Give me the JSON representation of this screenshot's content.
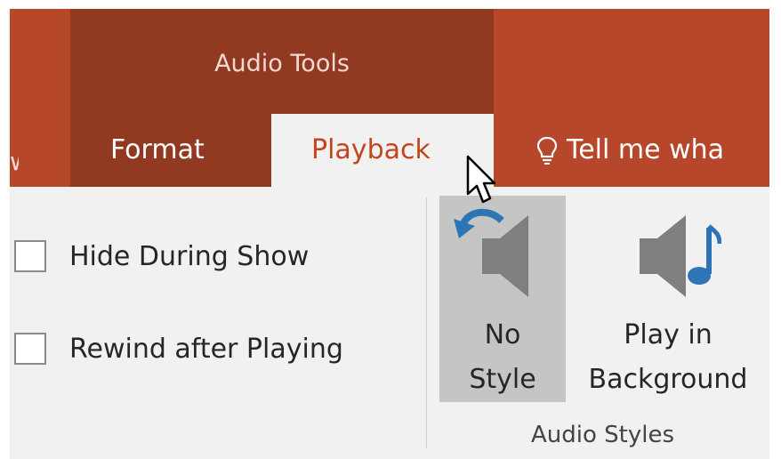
{
  "contextual_group": {
    "title": "Audio Tools"
  },
  "tabs": {
    "partial_left": "w",
    "format": "Format",
    "playback": "Playback",
    "tell_me": "Tell me wha"
  },
  "options": {
    "hide_during_show": "Hide During Show",
    "rewind_after_playing": "Rewind after Playing"
  },
  "audio_styles": {
    "no_style_line1": "No",
    "no_style_line2": "Style",
    "play_bg_line1": "Play in",
    "play_bg_line2": "Background",
    "group_label": "Audio Styles"
  },
  "icons": [
    "lightbulb-icon",
    "undo-arrow-icon",
    "speaker-icon",
    "speaker-music-note-icon",
    "mouse-cursor-icon"
  ],
  "colors": {
    "ribbon_title_band": "#B7472A",
    "contextual_band": "#923922",
    "active_tab_text": "#C4451C",
    "ribbon_body": "#F1F1F1",
    "selected_style_button": "#C5C5C5",
    "icon_blue": "#2E75B6"
  }
}
